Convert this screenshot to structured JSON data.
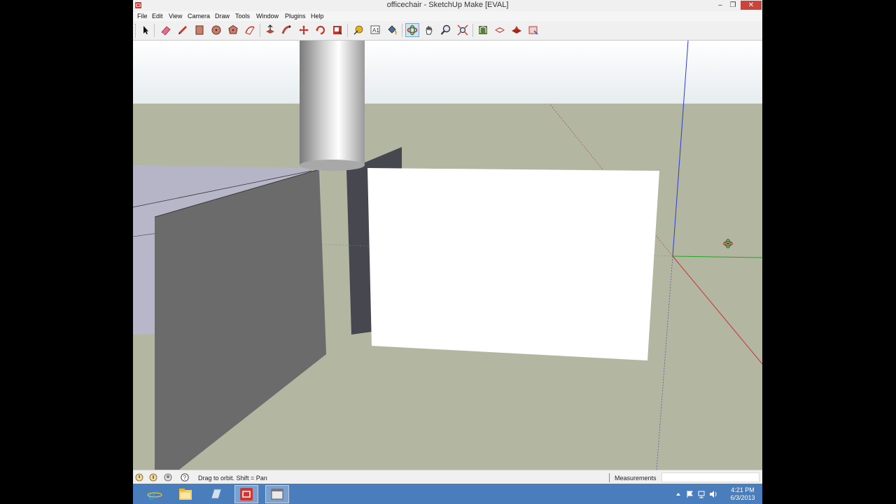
{
  "window": {
    "title": "officechair - SketchUp Make [EVAL]",
    "controls": {
      "minimize": "–",
      "restore": "❐",
      "close": "✕"
    }
  },
  "menu": [
    "File",
    "Edit",
    "View",
    "Camera",
    "Draw",
    "Tools",
    "Window",
    "Plugins",
    "Help"
  ],
  "toolbar": {
    "tools": [
      "select-icon",
      "eraser-icon",
      "pencil-icon",
      "rectangle-icon",
      "circle-icon",
      "polygon-icon",
      "arc-icon",
      "push-pull-icon",
      "follow-me-icon",
      "move-icon",
      "rotate-icon",
      "scale-icon",
      "tape-measure-icon",
      "text-icon",
      "paint-bucket-icon",
      "orbit-icon",
      "pan-icon",
      "zoom-icon",
      "zoom-extents-icon",
      "3d-warehouse-icon",
      "get-models-icon",
      "share-model-icon",
      "share-component-icon"
    ],
    "active_tool": "orbit-icon"
  },
  "status": {
    "hint": "Drag to orbit.  Shift = Pan",
    "measurements_label": "Measurements",
    "measurements_value": ""
  },
  "taskbar": {
    "apps": [
      "internet-explorer-icon",
      "file-explorer-icon",
      "store-app-icon",
      "sketchup-icon",
      "generic-window-icon"
    ],
    "time": "4:21 PM",
    "date": "6/3/2013"
  },
  "colors": {
    "sky": "#e6ecef",
    "ground": "#b3b7a1",
    "taskbar": "#4a7dbc",
    "close_button": "#c7453a"
  }
}
